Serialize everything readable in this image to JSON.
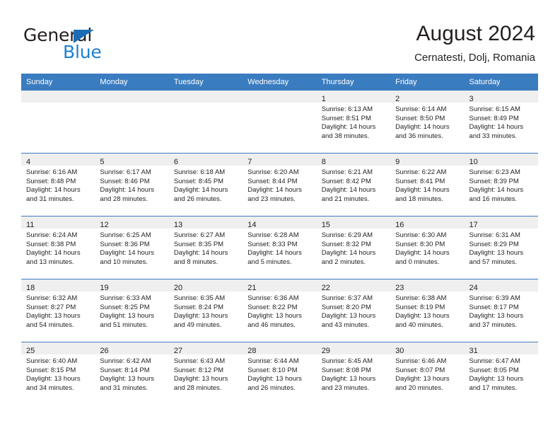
{
  "logo": {
    "word1": "General",
    "word2": "Blue",
    "triangle_color": "#1b6cb5",
    "word2_color": "#1b7fd4"
  },
  "header": {
    "title": "August 2024",
    "subtitle": "Cernatesti, Dolj, Romania"
  },
  "theme": {
    "header_blue": "#3a7cc0",
    "daynum_band": "#efefef",
    "text": "#231f20"
  },
  "weekdays": [
    "Sunday",
    "Monday",
    "Tuesday",
    "Wednesday",
    "Thursday",
    "Friday",
    "Saturday"
  ],
  "weeks": [
    [
      {
        "day": "",
        "sunrise": "",
        "sunset": "",
        "daylight1": "",
        "daylight2": ""
      },
      {
        "day": "",
        "sunrise": "",
        "sunset": "",
        "daylight1": "",
        "daylight2": ""
      },
      {
        "day": "",
        "sunrise": "",
        "sunset": "",
        "daylight1": "",
        "daylight2": ""
      },
      {
        "day": "",
        "sunrise": "",
        "sunset": "",
        "daylight1": "",
        "daylight2": ""
      },
      {
        "day": "1",
        "sunrise": "Sunrise: 6:13 AM",
        "sunset": "Sunset: 8:51 PM",
        "daylight1": "Daylight: 14 hours",
        "daylight2": "and 38 minutes."
      },
      {
        "day": "2",
        "sunrise": "Sunrise: 6:14 AM",
        "sunset": "Sunset: 8:50 PM",
        "daylight1": "Daylight: 14 hours",
        "daylight2": "and 36 minutes."
      },
      {
        "day": "3",
        "sunrise": "Sunrise: 6:15 AM",
        "sunset": "Sunset: 8:49 PM",
        "daylight1": "Daylight: 14 hours",
        "daylight2": "and 33 minutes."
      }
    ],
    [
      {
        "day": "4",
        "sunrise": "Sunrise: 6:16 AM",
        "sunset": "Sunset: 8:48 PM",
        "daylight1": "Daylight: 14 hours",
        "daylight2": "and 31 minutes."
      },
      {
        "day": "5",
        "sunrise": "Sunrise: 6:17 AM",
        "sunset": "Sunset: 8:46 PM",
        "daylight1": "Daylight: 14 hours",
        "daylight2": "and 28 minutes."
      },
      {
        "day": "6",
        "sunrise": "Sunrise: 6:18 AM",
        "sunset": "Sunset: 8:45 PM",
        "daylight1": "Daylight: 14 hours",
        "daylight2": "and 26 minutes."
      },
      {
        "day": "7",
        "sunrise": "Sunrise: 6:20 AM",
        "sunset": "Sunset: 8:44 PM",
        "daylight1": "Daylight: 14 hours",
        "daylight2": "and 23 minutes."
      },
      {
        "day": "8",
        "sunrise": "Sunrise: 6:21 AM",
        "sunset": "Sunset: 8:42 PM",
        "daylight1": "Daylight: 14 hours",
        "daylight2": "and 21 minutes."
      },
      {
        "day": "9",
        "sunrise": "Sunrise: 6:22 AM",
        "sunset": "Sunset: 8:41 PM",
        "daylight1": "Daylight: 14 hours",
        "daylight2": "and 18 minutes."
      },
      {
        "day": "10",
        "sunrise": "Sunrise: 6:23 AM",
        "sunset": "Sunset: 8:39 PM",
        "daylight1": "Daylight: 14 hours",
        "daylight2": "and 16 minutes."
      }
    ],
    [
      {
        "day": "11",
        "sunrise": "Sunrise: 6:24 AM",
        "sunset": "Sunset: 8:38 PM",
        "daylight1": "Daylight: 14 hours",
        "daylight2": "and 13 minutes."
      },
      {
        "day": "12",
        "sunrise": "Sunrise: 6:25 AM",
        "sunset": "Sunset: 8:36 PM",
        "daylight1": "Daylight: 14 hours",
        "daylight2": "and 10 minutes."
      },
      {
        "day": "13",
        "sunrise": "Sunrise: 6:27 AM",
        "sunset": "Sunset: 8:35 PM",
        "daylight1": "Daylight: 14 hours",
        "daylight2": "and 8 minutes."
      },
      {
        "day": "14",
        "sunrise": "Sunrise: 6:28 AM",
        "sunset": "Sunset: 8:33 PM",
        "daylight1": "Daylight: 14 hours",
        "daylight2": "and 5 minutes."
      },
      {
        "day": "15",
        "sunrise": "Sunrise: 6:29 AM",
        "sunset": "Sunset: 8:32 PM",
        "daylight1": "Daylight: 14 hours",
        "daylight2": "and 2 minutes."
      },
      {
        "day": "16",
        "sunrise": "Sunrise: 6:30 AM",
        "sunset": "Sunset: 8:30 PM",
        "daylight1": "Daylight: 14 hours",
        "daylight2": "and 0 minutes."
      },
      {
        "day": "17",
        "sunrise": "Sunrise: 6:31 AM",
        "sunset": "Sunset: 8:29 PM",
        "daylight1": "Daylight: 13 hours",
        "daylight2": "and 57 minutes."
      }
    ],
    [
      {
        "day": "18",
        "sunrise": "Sunrise: 6:32 AM",
        "sunset": "Sunset: 8:27 PM",
        "daylight1": "Daylight: 13 hours",
        "daylight2": "and 54 minutes."
      },
      {
        "day": "19",
        "sunrise": "Sunrise: 6:33 AM",
        "sunset": "Sunset: 8:25 PM",
        "daylight1": "Daylight: 13 hours",
        "daylight2": "and 51 minutes."
      },
      {
        "day": "20",
        "sunrise": "Sunrise: 6:35 AM",
        "sunset": "Sunset: 8:24 PM",
        "daylight1": "Daylight: 13 hours",
        "daylight2": "and 49 minutes."
      },
      {
        "day": "21",
        "sunrise": "Sunrise: 6:36 AM",
        "sunset": "Sunset: 8:22 PM",
        "daylight1": "Daylight: 13 hours",
        "daylight2": "and 46 minutes."
      },
      {
        "day": "22",
        "sunrise": "Sunrise: 6:37 AM",
        "sunset": "Sunset: 8:20 PM",
        "daylight1": "Daylight: 13 hours",
        "daylight2": "and 43 minutes."
      },
      {
        "day": "23",
        "sunrise": "Sunrise: 6:38 AM",
        "sunset": "Sunset: 8:19 PM",
        "daylight1": "Daylight: 13 hours",
        "daylight2": "and 40 minutes."
      },
      {
        "day": "24",
        "sunrise": "Sunrise: 6:39 AM",
        "sunset": "Sunset: 8:17 PM",
        "daylight1": "Daylight: 13 hours",
        "daylight2": "and 37 minutes."
      }
    ],
    [
      {
        "day": "25",
        "sunrise": "Sunrise: 6:40 AM",
        "sunset": "Sunset: 8:15 PM",
        "daylight1": "Daylight: 13 hours",
        "daylight2": "and 34 minutes."
      },
      {
        "day": "26",
        "sunrise": "Sunrise: 6:42 AM",
        "sunset": "Sunset: 8:14 PM",
        "daylight1": "Daylight: 13 hours",
        "daylight2": "and 31 minutes."
      },
      {
        "day": "27",
        "sunrise": "Sunrise: 6:43 AM",
        "sunset": "Sunset: 8:12 PM",
        "daylight1": "Daylight: 13 hours",
        "daylight2": "and 28 minutes."
      },
      {
        "day": "28",
        "sunrise": "Sunrise: 6:44 AM",
        "sunset": "Sunset: 8:10 PM",
        "daylight1": "Daylight: 13 hours",
        "daylight2": "and 26 minutes."
      },
      {
        "day": "29",
        "sunrise": "Sunrise: 6:45 AM",
        "sunset": "Sunset: 8:08 PM",
        "daylight1": "Daylight: 13 hours",
        "daylight2": "and 23 minutes."
      },
      {
        "day": "30",
        "sunrise": "Sunrise: 6:46 AM",
        "sunset": "Sunset: 8:07 PM",
        "daylight1": "Daylight: 13 hours",
        "daylight2": "and 20 minutes."
      },
      {
        "day": "31",
        "sunrise": "Sunrise: 6:47 AM",
        "sunset": "Sunset: 8:05 PM",
        "daylight1": "Daylight: 13 hours",
        "daylight2": "and 17 minutes."
      }
    ]
  ]
}
